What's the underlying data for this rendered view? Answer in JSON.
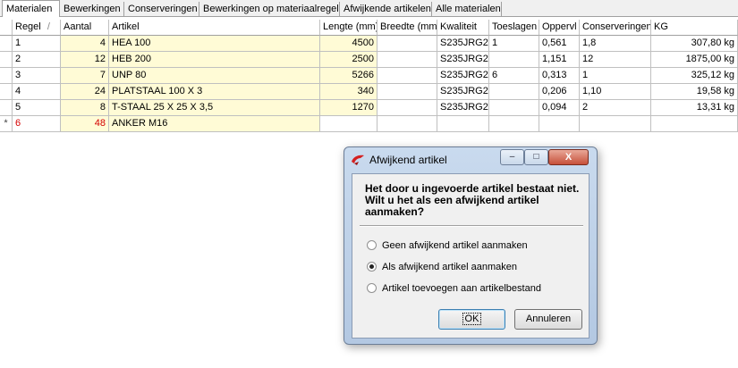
{
  "tabs": [
    {
      "label": "Materialen",
      "active": true
    },
    {
      "label": "Bewerkingen",
      "active": false
    },
    {
      "label": "Conserveringen",
      "active": false
    },
    {
      "label": "Bewerkingen op materiaalregel",
      "active": false
    },
    {
      "label": "Afwijkende artikelen",
      "active": false
    },
    {
      "label": "Alle materialen",
      "active": false
    }
  ],
  "table": {
    "columns": [
      "Regel",
      "Aantal",
      "Artikel",
      "Lengte (mm)",
      "Breedte (mm)",
      "Kwaliteit",
      "Toeslagen",
      "Oppervl",
      "Conserveringen",
      "KG"
    ],
    "sort_indicator": "/",
    "new_row_marker": "*",
    "rows": [
      {
        "regel": "1",
        "aantal": "4",
        "artikel": "HEA  100",
        "lengte": "4500",
        "breedte": "",
        "kwaliteit": "S235JRG2",
        "toeslagen": "1",
        "oppervl": "0,561",
        "conserveringen": "1,8",
        "kg": "307,80 kg"
      },
      {
        "regel": "2",
        "aantal": "12",
        "artikel": "HEB  200",
        "lengte": "2500",
        "breedte": "",
        "kwaliteit": "S235JRG2",
        "toeslagen": "",
        "oppervl": "1,151",
        "conserveringen": "12",
        "kg": "1875,00 kg"
      },
      {
        "regel": "3",
        "aantal": "7",
        "artikel": "UNP  80",
        "lengte": "5266",
        "breedte": "",
        "kwaliteit": "S235JRG2",
        "toeslagen": "6",
        "oppervl": "0,313",
        "conserveringen": "1",
        "kg": "325,12 kg"
      },
      {
        "regel": "4",
        "aantal": "24",
        "artikel": "PLATSTAAL 100 X 3",
        "lengte": "340",
        "breedte": "",
        "kwaliteit": "S235JRG2",
        "toeslagen": "",
        "oppervl": "0,206",
        "conserveringen": "1,10",
        "kg": "19,58 kg"
      },
      {
        "regel": "5",
        "aantal": "8",
        "artikel": "T-STAAL 25 X 25 X 3,5",
        "lengte": "1270",
        "breedte": "",
        "kwaliteit": "S235JRG2",
        "toeslagen": "",
        "oppervl": "0,094",
        "conserveringen": "2",
        "kg": "13,31 kg"
      },
      {
        "regel": "6",
        "aantal": "48",
        "artikel": "ANKER M16",
        "lengte": "",
        "breedte": "",
        "kwaliteit": "",
        "toeslagen": "",
        "oppervl": "",
        "conserveringen": "",
        "kg": ""
      }
    ]
  },
  "dialog": {
    "title": "Afwijkend artikel",
    "controls": {
      "minimize": "–",
      "maximize": "□",
      "close": "X"
    },
    "message": "Het door u ingevoerde artikel bestaat niet. Wilt u het als een afwijkend artikel aanmaken?",
    "options": [
      {
        "label": "Geen afwijkend artikel aanmaken",
        "selected": false
      },
      {
        "label": "Als afwijkend artikel aanmaken",
        "selected": true
      },
      {
        "label": "Artikel toevoegen aan artikelbestand",
        "selected": false
      }
    ],
    "ok_label": "OK",
    "cancel_label": "Annuleren"
  },
  "colors": {
    "highlight_row": "#fffbd6",
    "new_row_text": "#d40000",
    "accent": "#3c7fb1"
  }
}
